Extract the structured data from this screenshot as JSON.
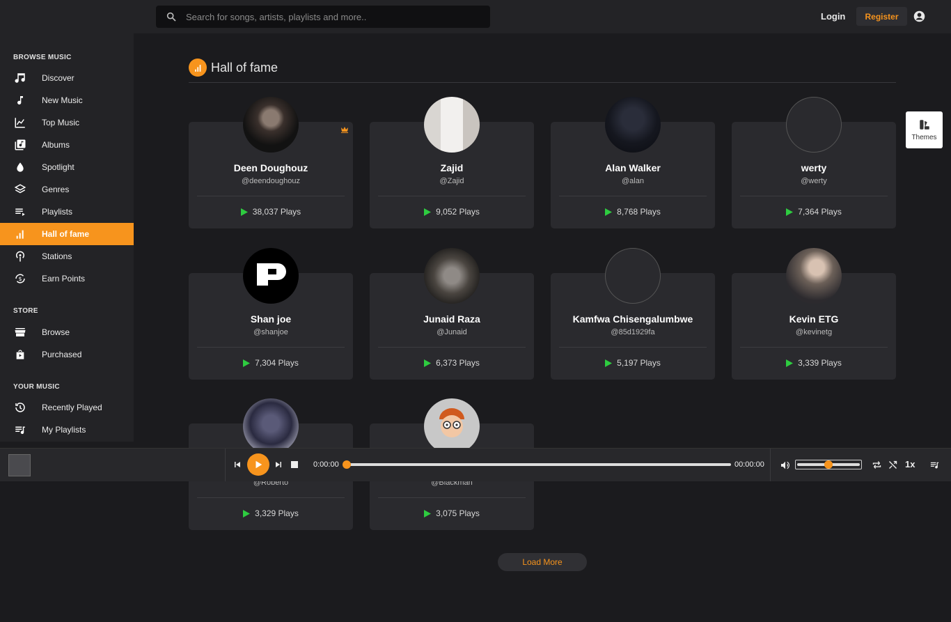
{
  "search": {
    "placeholder": "Search for songs, artists, playlists and more.."
  },
  "header": {
    "login": "Login",
    "register": "Register"
  },
  "sidebar": {
    "browse_title": "BROWSE MUSIC",
    "store_title": "STORE",
    "your_music_title": "YOUR MUSIC",
    "browse": [
      {
        "label": "Discover",
        "icon": "music-note-icon"
      },
      {
        "label": "New Music",
        "icon": "note-icon"
      },
      {
        "label": "Top Music",
        "icon": "trending-icon"
      },
      {
        "label": "Albums",
        "icon": "album-icon"
      },
      {
        "label": "Spotlight",
        "icon": "drop-icon"
      },
      {
        "label": "Genres",
        "icon": "layers-icon"
      },
      {
        "label": "Playlists",
        "icon": "playlist-icon"
      },
      {
        "label": "Hall of fame",
        "icon": "bar-chart-icon",
        "active": true
      },
      {
        "label": "Stations",
        "icon": "podcast-icon"
      },
      {
        "label": "Earn Points",
        "icon": "coin-icon"
      }
    ],
    "store": [
      {
        "label": "Browse",
        "icon": "store-icon"
      },
      {
        "label": "Purchased",
        "icon": "bag-icon"
      }
    ],
    "your_music": [
      {
        "label": "Recently Played",
        "icon": "history-icon"
      },
      {
        "label": "My Playlists",
        "icon": "queue-music-icon"
      }
    ]
  },
  "page": {
    "title": "Hall of fame",
    "load_more": "Load More"
  },
  "artists": [
    {
      "name": "Deen Doughouz",
      "handle": "@deendoughouz",
      "plays": "38,037 Plays",
      "crown": true
    },
    {
      "name": "Zajid",
      "handle": "@Zajid",
      "plays": "9,052 Plays"
    },
    {
      "name": "Alan Walker",
      "handle": "@alan",
      "plays": "8,768 Plays"
    },
    {
      "name": "werty",
      "handle": "@werty",
      "plays": "7,364 Plays"
    },
    {
      "name": "Shan joe",
      "handle": "@shanjoe",
      "plays": "7,304 Plays"
    },
    {
      "name": "Junaid Raza",
      "handle": "@Junaid",
      "plays": "6,373 Plays"
    },
    {
      "name": "Kamfwa Chisengalumbwe",
      "handle": "@85d1929fa",
      "plays": "5,197 Plays"
    },
    {
      "name": "Kevin ETG",
      "handle": "@kevinetg",
      "plays": "3,339 Plays"
    },
    {
      "name": "",
      "handle": "@Roberto",
      "plays": "3,329 Plays"
    },
    {
      "name": "",
      "handle": "@Blackman",
      "plays": "3,075 Plays"
    }
  ],
  "themes": {
    "label": "Themes"
  },
  "player": {
    "time_current": "0:00:00",
    "time_total": "00:00:00",
    "speed": "1x",
    "progress": 0,
    "volume": 0.5
  },
  "colors": {
    "accent": "#f7941d",
    "play_green": "#2ecc40",
    "background": "#1b1b1e",
    "panel": "#232326",
    "card": "#2a2a2e"
  }
}
